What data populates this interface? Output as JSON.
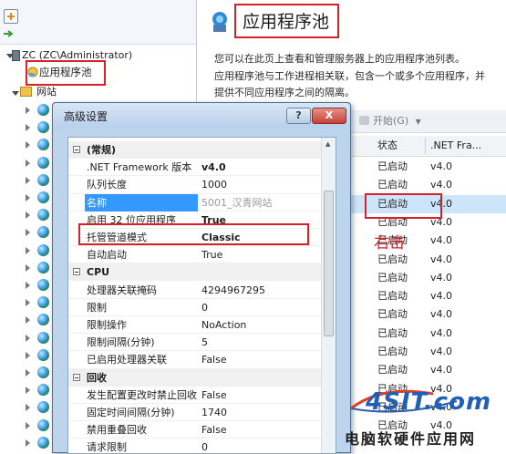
{
  "tree": {
    "root_label": "ZC (ZC\\Administrator)",
    "app_pools_label": "应用程序池",
    "sites_label": "网站"
  },
  "content": {
    "page_title": "应用程序池",
    "description_lines": [
      "您可以在此页上查看和管理服务器上的应用程序池列表。",
      "应用程序池与工作进程相关联，包含一个或多个应用程序，并",
      "提供不同应用程序之间的隔离。"
    ],
    "start_button": "开始(G)",
    "col_status": "状态",
    "col_framework": ".NET Fra...",
    "rows": [
      {
        "status": "已启动",
        "fw": "v4.0"
      },
      {
        "status": "已启动",
        "fw": "v4.0"
      },
      {
        "status": "已启动",
        "fw": "v4.0"
      },
      {
        "status": "已启动",
        "fw": "v4.0"
      },
      {
        "status": "已启动",
        "fw": "v4.0"
      },
      {
        "status": "已启动",
        "fw": "v4.0"
      },
      {
        "status": "已启动",
        "fw": "v4.0"
      },
      {
        "status": "已启动",
        "fw": "v4.0"
      },
      {
        "status": "已启动",
        "fw": "v4.0"
      },
      {
        "status": "已启动",
        "fw": "v4.0"
      },
      {
        "status": "已启动",
        "fw": "v4.0"
      },
      {
        "status": "已启动",
        "fw": "v4.0"
      },
      {
        "status": "已启动",
        "fw": "v4.0"
      },
      {
        "status": "已启动",
        "fw": "v4.0"
      },
      {
        "status": "已启动",
        "fw": "v4.0"
      }
    ],
    "annotation": "右击"
  },
  "dialog": {
    "title": "高级设置",
    "help_glyph": "?",
    "close_glyph": "X",
    "categories": {
      "general": "(常规)",
      "cpu": "CPU",
      "recycling": "回收"
    },
    "general_props": [
      {
        "name": ".NET Framework 版本",
        "value": "v4.0"
      },
      {
        "name": "队列长度",
        "value": "1000"
      },
      {
        "name": "名称",
        "value": "5001_汉青网站"
      },
      {
        "name": "启用 32 位应用程序",
        "value": "True"
      },
      {
        "name": "托管管道模式",
        "value": "Classic"
      },
      {
        "name": "自动启动",
        "value": "True"
      }
    ],
    "cpu_props": [
      {
        "name": "处理器关联掩码",
        "value": "4294967295"
      },
      {
        "name": "限制",
        "value": "0"
      },
      {
        "name": "限制操作",
        "value": "NoAction"
      },
      {
        "name": "限制间隔(分钟)",
        "value": "5"
      },
      {
        "name": "已启用处理器关联",
        "value": "False"
      }
    ],
    "recycling_props": [
      {
        "name": "发生配置更改时禁止回收",
        "value": "False"
      },
      {
        "name": "固定时间间隔(分钟)",
        "value": "1740"
      },
      {
        "name": "禁用重叠回收",
        "value": "False"
      },
      {
        "name": "请求限制",
        "value": "0"
      }
    ]
  },
  "watermark": {
    "logo": "4SIT.com",
    "caption": "电脑软硬件应用网"
  },
  "colors": {
    "highlight_red": "#d8202a",
    "selection_blue": "#3399ff",
    "dialog_frame": "#bcd4ec",
    "close_red": "#c8413a"
  }
}
